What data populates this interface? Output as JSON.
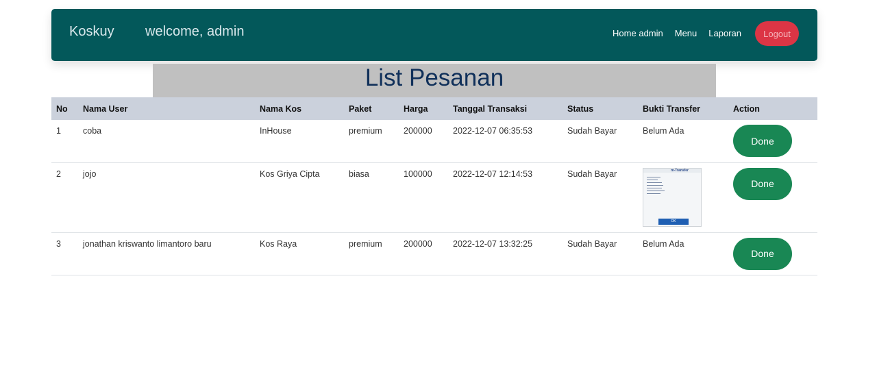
{
  "navbar": {
    "brand": "Koskuy",
    "welcome": "welcome, admin",
    "links": [
      "Home admin",
      "Menu",
      "Laporan"
    ],
    "logout_label": "Logout",
    "bg_color": "#03585a"
  },
  "page_title": "List Pesanan",
  "table": {
    "headers": [
      "No",
      "Nama User",
      "Nama Kos",
      "Paket",
      "Harga",
      "Tanggal Transaksi",
      "Status",
      "Bukti Transfer",
      "Action"
    ],
    "rows": [
      {
        "no": "1",
        "user": "coba",
        "kos": "InHouse",
        "paket": "premium",
        "harga": "200000",
        "tanggal": "2022-12-07 06:35:53",
        "status": "Sudah Bayar",
        "bukti": "Belum Ada",
        "action": "Done"
      },
      {
        "no": "2",
        "user": "jojo",
        "kos": "Kos Griya Cipta",
        "paket": "biasa",
        "harga": "100000",
        "tanggal": "2022-12-07 12:14:53",
        "status": "Sudah Bayar",
        "bukti_image_title": "m-Transfer",
        "bukti_image_button": "OK",
        "action": "Done"
      },
      {
        "no": "3",
        "user": "jonathan kriswanto limantoro baru",
        "kos": "Kos Raya",
        "paket": "premium",
        "harga": "200000",
        "tanggal": "2022-12-07 13:32:25",
        "status": "Sudah Bayar",
        "bukti": "Belum Ada",
        "action": "Done"
      }
    ]
  },
  "colors": {
    "done_button": "#198754",
    "logout_button": "#dc3545",
    "table_header": "#cbd1dc",
    "title_bar": "#c0c0c0"
  }
}
